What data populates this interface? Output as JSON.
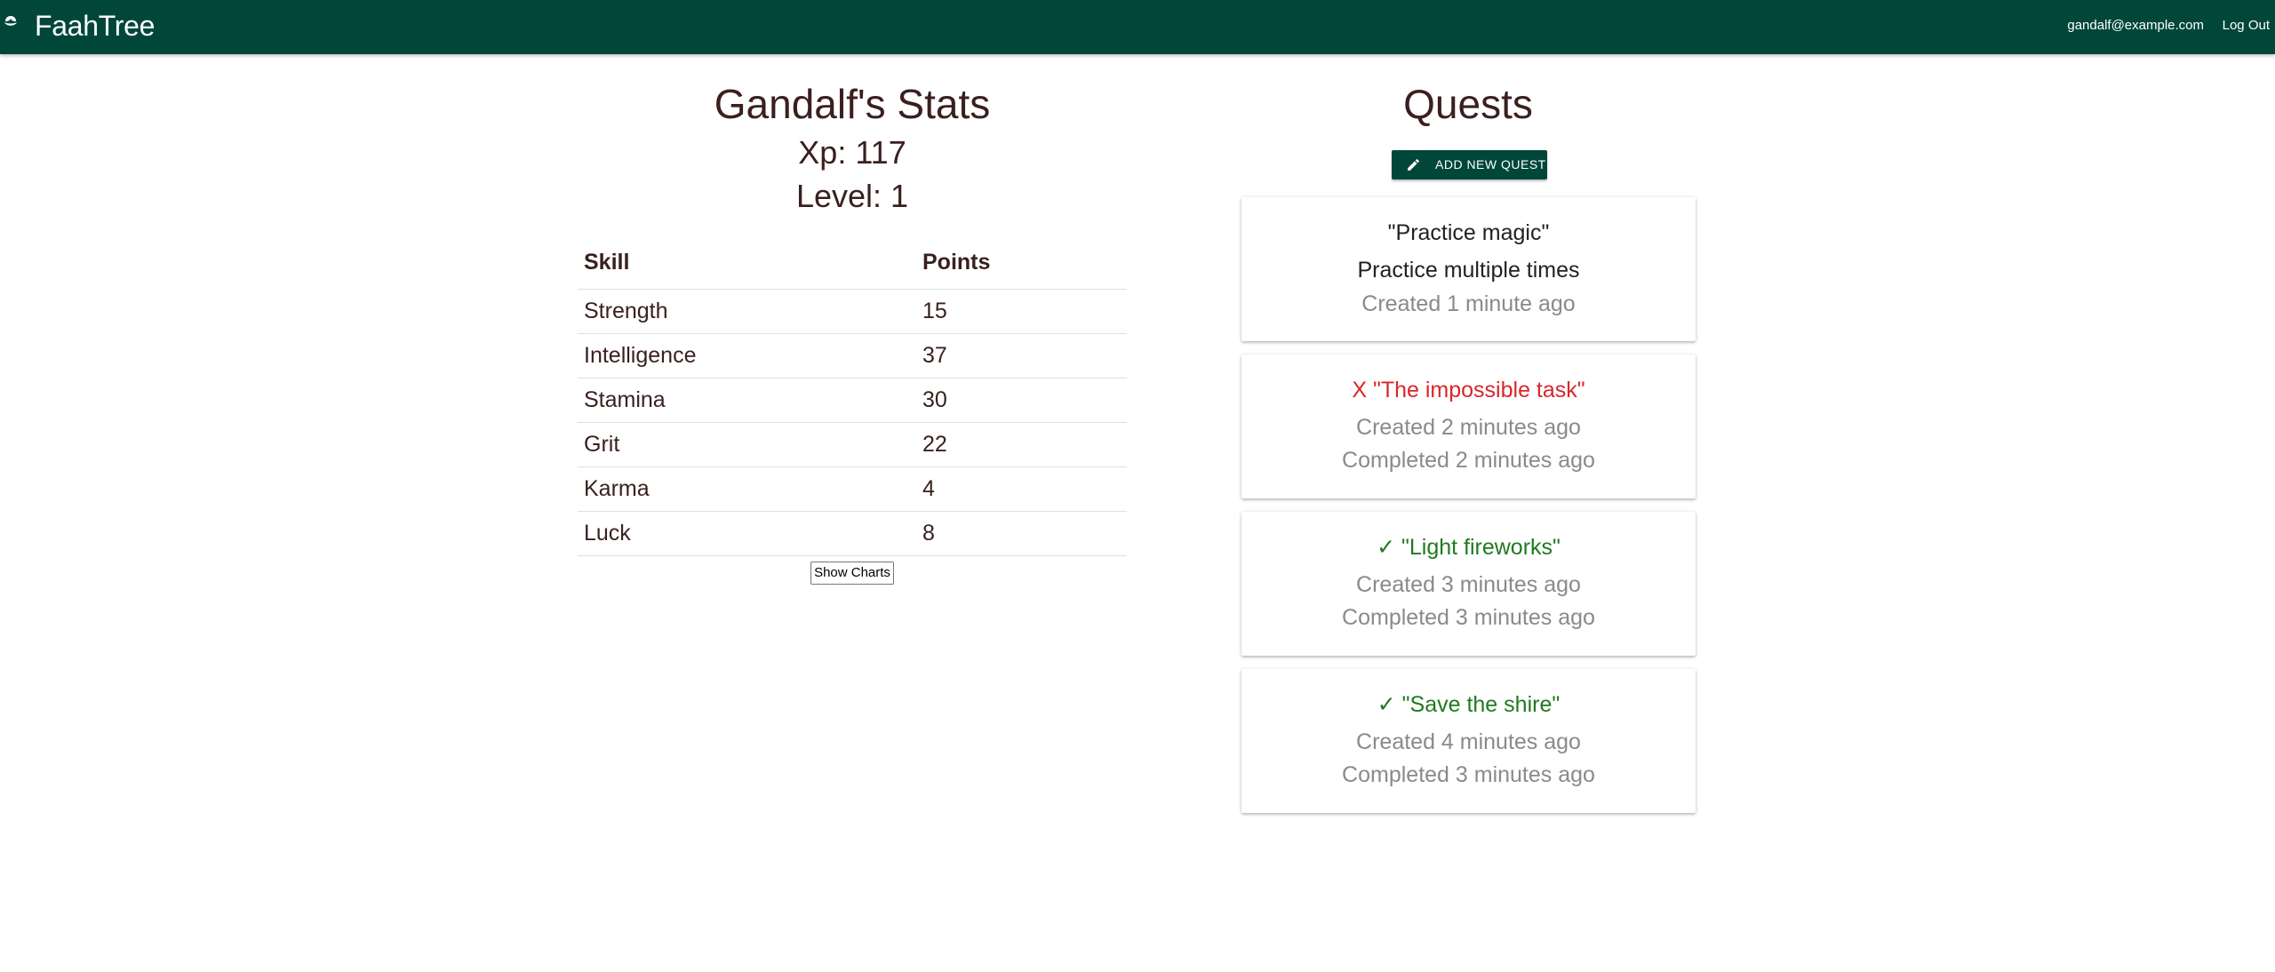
{
  "app": {
    "brand_name": "FaahTree",
    "user_email": "gandalf@example.com",
    "logout_label": "Log Out",
    "brand_color": "#00473a"
  },
  "stats": {
    "title": "Gandalf's Stats",
    "xp_text": "Xp: 117",
    "level_text": "Level: 1",
    "table": {
      "headers": [
        "Skill",
        "Points"
      ],
      "rows": [
        [
          "Strength",
          "15"
        ],
        [
          "Intelligence",
          "37"
        ],
        [
          "Stamina",
          "30"
        ],
        [
          "Grit",
          "22"
        ],
        [
          "Karma",
          "4"
        ],
        [
          "Luck",
          "8"
        ]
      ]
    },
    "show_charts_label": "Show Charts"
  },
  "quests": {
    "title": "Quests",
    "add_button_label": "Add new quest",
    "add_button_icon": "pencil-icon",
    "items": [
      {
        "status": "open",
        "title": "\"Practice magic\"",
        "description": "Practice multiple times",
        "created": "Created 1 minute ago"
      },
      {
        "status": "failed",
        "title": "X \"The impossible task\"",
        "created": "Created 2 minutes ago",
        "completed": "Completed 2 minutes ago",
        "color": "#d9262b"
      },
      {
        "status": "done",
        "title": "✓ \"Light fireworks\"",
        "created": "Created 3 minutes ago",
        "completed": "Completed 3 minutes ago",
        "color": "#1f7a1f"
      },
      {
        "status": "done",
        "title": "✓ \"Save the shire\"",
        "created": "Created 4 minutes ago",
        "completed": "Completed 3 minutes ago",
        "color": "#1f7a1f"
      }
    ]
  }
}
